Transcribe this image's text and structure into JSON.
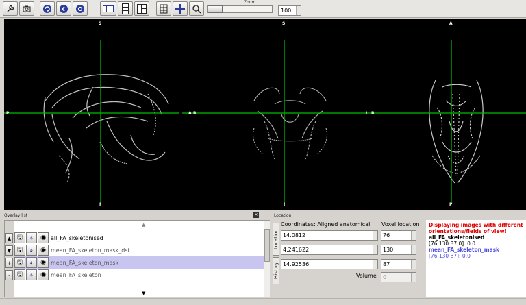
{
  "toolbar": {
    "zoom_label": "Zoom",
    "zoom_value": "100",
    "zoom_fraction": 0.0,
    "icons": [
      "wrench-icon",
      "camera-icon",
      "link-rotate-icon",
      "link-left-icon",
      "link-center-icon",
      "single-view-icon",
      "triple-view-icon",
      "ortho-view-icon",
      "movie-icon",
      "crosshair-icon",
      "magnifier-icon"
    ]
  },
  "viewer": {
    "orientation_labels": {
      "left_top": "S",
      "left_bottom": "I",
      "left_left": "P",
      "left_right": "A",
      "mid_top": "S",
      "mid_bottom": "I",
      "mid_left": "R",
      "mid_right": "L",
      "right_top": "A",
      "right_bottom": "P",
      "right_left": "R",
      "right_right": ""
    },
    "crosshair_color": "#00c000",
    "background": "#000000"
  },
  "overlay_list": {
    "title": "Overlay list",
    "items": [
      {
        "name": "all_FA_skeletonised",
        "active": true,
        "selected": false
      },
      {
        "name": "mean_FA_skeleton_mask_dst",
        "active": false,
        "selected": false
      },
      {
        "name": "mean_FA_skeleton_mask",
        "active": false,
        "selected": true
      },
      {
        "name": "mean_FA_skeleton",
        "active": false,
        "selected": false
      }
    ],
    "move_buttons": [
      "▲",
      "▼",
      "+",
      "-"
    ]
  },
  "location": {
    "title": "Location",
    "tab_location": "Location",
    "tab_history": "History",
    "coords_header": "Coordinates: Aligned anatomical",
    "voxel_header": "Voxel location",
    "coords": [
      "14.0812",
      "4.241622",
      "14.92536"
    ],
    "voxels": [
      "76",
      "130",
      "87"
    ],
    "volume_label": "Volume",
    "volume_value": "0",
    "warning": "Displaying images with different orientations/fields of view!",
    "overlay1_name": "all_FA_skeletonised",
    "overlay1_value": "[76 130 87 0]: 0.0",
    "overlay2_name": "mean_FA_skeleton_mask",
    "overlay2_value": "[76 130 87]: 0.0",
    "warning_color": "#e00000",
    "overlay2_color": "#5050e0"
  }
}
